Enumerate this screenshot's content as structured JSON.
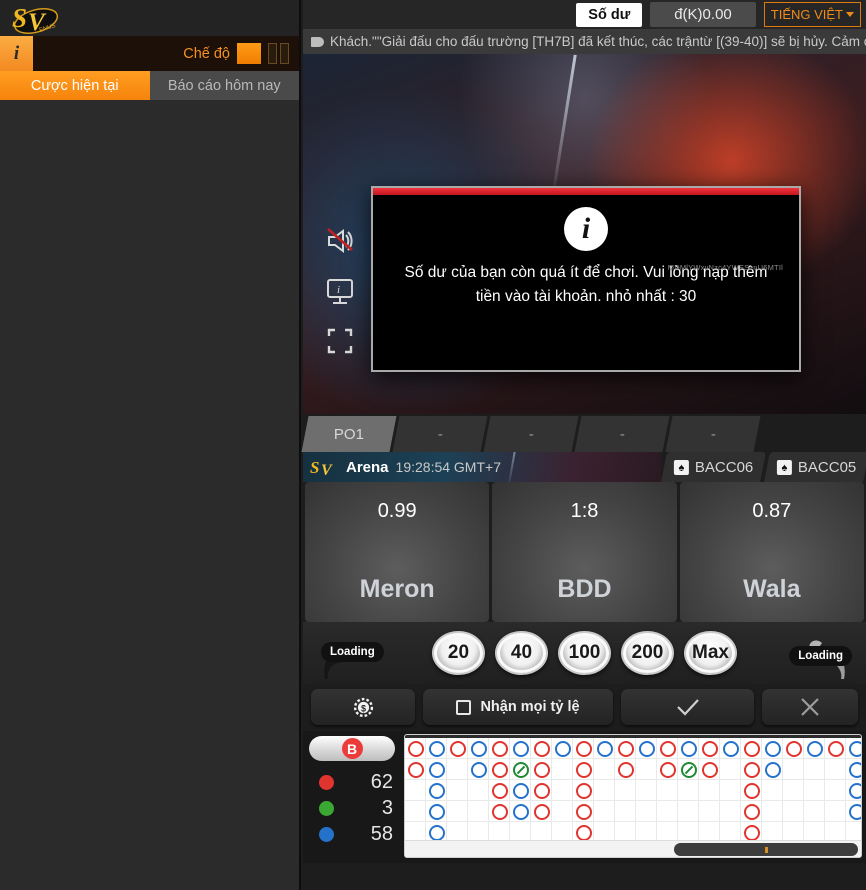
{
  "left": {
    "logo_text": "SV",
    "logo_sub": "ENUS",
    "info_icon_label": "i",
    "mode_label": "Chế độ",
    "tabs": [
      {
        "label": "Cược hiện tại",
        "active": true
      },
      {
        "label": "Báo cáo hôm nay",
        "active": false
      }
    ]
  },
  "topbar": {
    "balance_label": "Số dư",
    "balance_value": "đ(K)0.00",
    "language": "TIẾNG VIỆT",
    "caret_icon": "chevron-down-icon"
  },
  "marquee": {
    "icon": "megaphone-icon",
    "text": "Khách.\"\"Giải đấu cho đấu trường [TH7B] đã kết thúc, các trậntừ [(39-40)] sẽ bị hủy. Cảm ơn s"
  },
  "video": {
    "controls": [
      {
        "name": "mute-icon",
        "label": "muted-speaker"
      },
      {
        "name": "screen-quality-icon",
        "label": "monitor"
      },
      {
        "name": "fullscreen-icon",
        "label": "expand"
      }
    ]
  },
  "dialog": {
    "icon": "info-icon",
    "message_line1": "Số dư của bạn còn quá ít để chơi. Vui lòng nạp thêm",
    "message_line2": "tiền vào tài khoản. nhỏ nhất : 30",
    "watermark": "MDMlYWxvNzc4YWEScnU6MTIl",
    "accent_color": "#e0242e"
  },
  "arena_tabs": [
    {
      "label": "PO1",
      "active": true
    },
    {
      "label": "-",
      "active": false
    },
    {
      "label": "-",
      "active": false
    },
    {
      "label": "-",
      "active": false
    },
    {
      "label": "-",
      "active": false
    }
  ],
  "arena": {
    "logo": "SV",
    "name": "Arena",
    "time": "19:28:54 GMT+7",
    "rooms": [
      {
        "label": "BACC06",
        "icon": "spade-icon"
      },
      {
        "label": "BACC05",
        "icon": "spade-icon"
      }
    ]
  },
  "odds": [
    {
      "value": "0.99",
      "name": "Meron"
    },
    {
      "value": "1:8",
      "name": "BDD"
    },
    {
      "value": "0.87",
      "name": "Wala"
    }
  ],
  "chips": {
    "loading_left": "Loading",
    "loading_right": "Loading",
    "values": [
      "20",
      "40",
      "100",
      "200",
      "Max"
    ]
  },
  "actions": [
    {
      "name": "settings-button",
      "icon": "coin-gear-icon",
      "label": ""
    },
    {
      "name": "accept-all-odds-button",
      "icon": "checkbox-icon",
      "label": "Nhận mọi tỷ lệ"
    },
    {
      "name": "confirm-button",
      "icon": "check-icon",
      "label": ""
    },
    {
      "name": "cancel-button",
      "icon": "close-icon",
      "label": ""
    }
  ],
  "board": {
    "toggle_label": "B",
    "stats": [
      {
        "color": "#e0342f",
        "value": "62"
      },
      {
        "color": "#3aa832",
        "value": "3"
      },
      {
        "color": "#2572cb",
        "value": "58"
      }
    ],
    "colors": {
      "meron": "#e0342f",
      "wala": "#2572cb",
      "tie": "#1f8a33"
    },
    "rows": 6,
    "cols": 28,
    "cell": 21,
    "marks": [
      {
        "c": 0,
        "r": 0,
        "k": "r"
      },
      {
        "c": 0,
        "r": 1,
        "k": "r"
      },
      {
        "c": 1,
        "r": 0,
        "k": "b"
      },
      {
        "c": 1,
        "r": 1,
        "k": "b"
      },
      {
        "c": 1,
        "r": 2,
        "k": "b"
      },
      {
        "c": 1,
        "r": 3,
        "k": "b"
      },
      {
        "c": 1,
        "r": 4,
        "k": "b"
      },
      {
        "c": 1,
        "r": 5,
        "k": "b"
      },
      {
        "c": 2,
        "r": 0,
        "k": "r"
      },
      {
        "c": 2,
        "r": 5,
        "k": "b"
      },
      {
        "c": 3,
        "r": 0,
        "k": "b"
      },
      {
        "c": 3,
        "r": 1,
        "k": "b"
      },
      {
        "c": 4,
        "r": 0,
        "k": "r"
      },
      {
        "c": 4,
        "r": 1,
        "k": "r"
      },
      {
        "c": 4,
        "r": 2,
        "k": "r"
      },
      {
        "c": 4,
        "r": 3,
        "k": "r"
      },
      {
        "c": 5,
        "r": 0,
        "k": "b"
      },
      {
        "c": 5,
        "r": 1,
        "k": "t"
      },
      {
        "c": 5,
        "r": 2,
        "k": "b"
      },
      {
        "c": 5,
        "r": 3,
        "k": "b"
      },
      {
        "c": 6,
        "r": 0,
        "k": "r"
      },
      {
        "c": 6,
        "r": 1,
        "k": "r"
      },
      {
        "c": 6,
        "r": 2,
        "k": "r"
      },
      {
        "c": 6,
        "r": 3,
        "k": "r"
      },
      {
        "c": 7,
        "r": 0,
        "k": "b"
      },
      {
        "c": 8,
        "r": 0,
        "k": "r"
      },
      {
        "c": 8,
        "r": 1,
        "k": "r"
      },
      {
        "c": 8,
        "r": 2,
        "k": "r"
      },
      {
        "c": 8,
        "r": 3,
        "k": "r"
      },
      {
        "c": 8,
        "r": 4,
        "k": "r"
      },
      {
        "c": 9,
        "r": 0,
        "k": "b"
      },
      {
        "c": 10,
        "r": 0,
        "k": "r"
      },
      {
        "c": 10,
        "r": 1,
        "k": "r"
      },
      {
        "c": 11,
        "r": 0,
        "k": "b"
      },
      {
        "c": 12,
        "r": 0,
        "k": "r"
      },
      {
        "c": 12,
        "r": 1,
        "k": "r"
      },
      {
        "c": 13,
        "r": 0,
        "k": "b"
      },
      {
        "c": 13,
        "r": 1,
        "k": "t"
      },
      {
        "c": 14,
        "r": 0,
        "k": "r"
      },
      {
        "c": 14,
        "r": 1,
        "k": "r"
      },
      {
        "c": 15,
        "r": 0,
        "k": "b"
      },
      {
        "c": 16,
        "r": 0,
        "k": "r"
      },
      {
        "c": 16,
        "r": 1,
        "k": "r"
      },
      {
        "c": 16,
        "r": 2,
        "k": "r"
      },
      {
        "c": 16,
        "r": 3,
        "k": "r"
      },
      {
        "c": 16,
        "r": 4,
        "k": "r"
      },
      {
        "c": 16,
        "r": 5,
        "k": "r"
      },
      {
        "c": 17,
        "r": 0,
        "k": "b"
      },
      {
        "c": 17,
        "r": 1,
        "k": "b"
      },
      {
        "c": 17,
        "r": 5,
        "k": "r"
      },
      {
        "c": 18,
        "r": 0,
        "k": "r"
      },
      {
        "c": 18,
        "r": 5,
        "k": "r"
      },
      {
        "c": 19,
        "r": 0,
        "k": "b"
      },
      {
        "c": 19,
        "r": 5,
        "k": "r"
      },
      {
        "c": 20,
        "r": 0,
        "k": "r"
      },
      {
        "c": 21,
        "r": 0,
        "k": "b"
      },
      {
        "c": 21,
        "r": 1,
        "k": "b"
      },
      {
        "c": 21,
        "r": 2,
        "k": "b"
      },
      {
        "c": 21,
        "r": 3,
        "k": "b"
      },
      {
        "c": 22,
        "r": 0,
        "k": "r"
      },
      {
        "c": 23,
        "r": 0,
        "k": "b"
      },
      {
        "c": 23,
        "r": 1,
        "k": "t"
      }
    ]
  }
}
